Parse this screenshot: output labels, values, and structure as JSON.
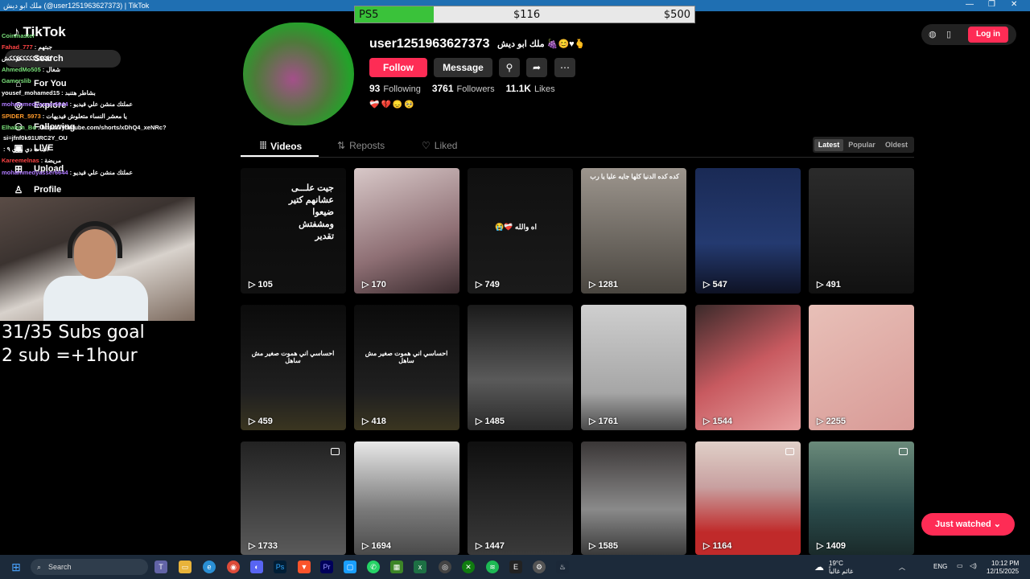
{
  "window": {
    "title": "ملك ابو ديش (@user1251963627373) | TikTok"
  },
  "goal": {
    "label": "PS5",
    "current": "$116",
    "target": "$500",
    "progress": 0.232
  },
  "sidebar": {
    "logo": "TikTok",
    "items": [
      {
        "label": "Search",
        "icon": "search-icon"
      },
      {
        "label": "For You",
        "icon": "home-icon"
      },
      {
        "label": "Explore",
        "icon": "compass-icon"
      },
      {
        "label": "Following",
        "icon": "users-icon"
      },
      {
        "label": "LIVE",
        "icon": "live-icon"
      },
      {
        "label": "Upload",
        "icon": "plus-square-icon"
      },
      {
        "label": "Profile",
        "icon": "person-icon"
      }
    ]
  },
  "chat": [
    {
      "user": "Coinmaster",
      "text": "",
      "color": "#7ae07a"
    },
    {
      "user": "Fahad_777",
      "text": ": جبتهم",
      "color": "#ff4444"
    },
    {
      "user": "",
      "text": "كككككككككككككش",
      "color": "#ff4444"
    },
    {
      "user": "AhmedMo505",
      "text": ": شغال",
      "color": "#7ae07a"
    },
    {
      "user": "Gamerslib",
      "text": "",
      "color": "#7ae07a"
    },
    {
      "user": "yousef_mohamed15",
      "text": ": بشاطر هتنبد",
      "color": "#ffffff"
    },
    {
      "user": "mohammedyasser6644",
      "text": ": عملتك منشن علي فيديو",
      "color": "#b07bff"
    },
    {
      "user": "SPIDER_5973",
      "text": ": يا معشر النساء متعلوش فيديهات",
      "color": "#ff9a2a"
    },
    {
      "user": "Elhakim_Bo",
      "text": ": https://youtube.com/shorts/xDhQ4_xeNRc?",
      "color": "#7ae07a"
    },
    {
      "user": "",
      "text": "si=jfnf0k91URC2Y_OU",
      "color": "#ffffff"
    },
    {
      "user": "",
      "text": ": البنات دي مري ٩",
      "color": "#ffffff"
    },
    {
      "user": "Kareemelnas",
      "text": ": مريضة",
      "color": "#ff4444"
    },
    {
      "user": "mohammedyasser6644",
      "text": ": عملتك منشن علي فيديو",
      "color": "#b07bff"
    }
  ],
  "overlay": {
    "line1": "31/35 Subs goal",
    "line2": "2 sub =+1hour"
  },
  "profile": {
    "username": "user1251963627373",
    "nickname": "ملك ابو ديش 🍇😊♥🫰",
    "follow_label": "Follow",
    "message_label": "Message",
    "following_count": "93",
    "following_label": "Following",
    "followers_count": "3761",
    "followers_label": "Followers",
    "likes_count": "11.1K",
    "likes_label": "Likes",
    "bio": "❤️‍🩹💔😞🥺"
  },
  "tabs": [
    {
      "label": "Videos",
      "icon": "grid-icon",
      "active": true
    },
    {
      "label": "Reposts",
      "icon": "repost-icon",
      "active": false
    },
    {
      "label": "Liked",
      "icon": "heart-icon",
      "active": false
    }
  ],
  "sort": {
    "latest": "Latest",
    "popular": "Popular",
    "oldest": "Oldest"
  },
  "topright": {
    "login": "Log in"
  },
  "videos": [
    {
      "views": "105",
      "text": "جيت علـــى عشانهم كتير ضيعوا ومشفتش تقدير"
    },
    {
      "views": "170",
      "text": ""
    },
    {
      "views": "749",
      "text": "اه والله ❤️‍🩹😭"
    },
    {
      "views": "1281",
      "text": "كده كده الدنيا كلها جايه عليا يا رب"
    },
    {
      "views": "547",
      "text": ""
    },
    {
      "views": "491",
      "text": ""
    },
    {
      "views": "459",
      "text": "احساسي اني هموت صغير مش ساهل"
    },
    {
      "views": "418",
      "text": "احساسي اني هموت صغير مش ساهل"
    },
    {
      "views": "1485",
      "text": ""
    },
    {
      "views": "1761",
      "text": ""
    },
    {
      "views": "1544",
      "text": ""
    },
    {
      "views": "2255",
      "text": ""
    },
    {
      "views": "1733",
      "text": ""
    },
    {
      "views": "1694",
      "text": ""
    },
    {
      "views": "1447",
      "text": ""
    },
    {
      "views": "1585",
      "text": ""
    },
    {
      "views": "1164",
      "text": ""
    },
    {
      "views": "1409",
      "text": ""
    }
  ],
  "just_watched": "Just watched",
  "taskbar": {
    "search": "Search",
    "weather_temp": "19°C",
    "weather_sub": "غائم غالباً",
    "lang": "ENG",
    "time": "10:12 PM",
    "date": "12/15/2025"
  }
}
